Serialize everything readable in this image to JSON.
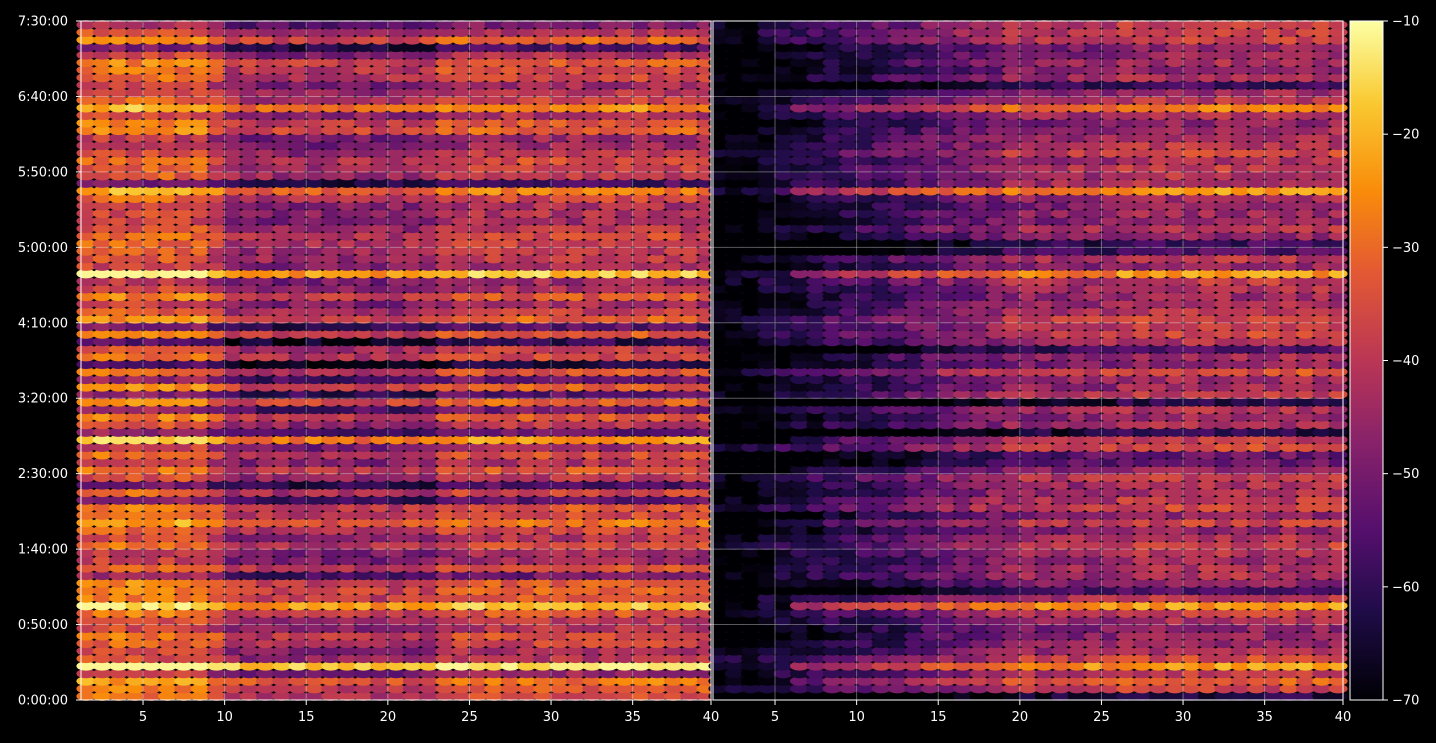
{
  "chart_data": {
    "type": "heatmap",
    "title": "",
    "xlabel": "",
    "ylabel": "",
    "panels": [
      {
        "name": "",
        "xlim": [
          1.2,
          39.8
        ],
        "x_tick_labels": [
          "5",
          "10",
          "15",
          "20",
          "25",
          "30",
          "35",
          "40"
        ],
        "x_tick_values": [
          5,
          10,
          15,
          20,
          25,
          30,
          35,
          40
        ],
        "rows": 90,
        "cols": 39,
        "description_level": "bright: levels mostly -45 to -25 dB, strong bands near -15 dB"
      },
      {
        "name": "",
        "xlim": [
          1.2,
          39.8
        ],
        "x_tick_labels": [
          "5",
          "10",
          "15",
          "20",
          "25",
          "30",
          "35",
          "40"
        ],
        "x_tick_values": [
          5,
          10,
          15,
          20,
          25,
          30,
          35,
          40
        ],
        "rows": 90,
        "cols": 39,
        "description_level": "dark left (x<6 ≈ -70 dB), rising to -45..-25 dB toward right"
      }
    ],
    "y_axis": {
      "ylim_seconds": [
        0,
        27000
      ],
      "tick_labels": [
        "0:00:00",
        "0:50:00",
        "1:40:00",
        "2:30:00",
        "3:20:00",
        "4:10:00",
        "5:00:00",
        "5:50:00",
        "6:40:00",
        "7:30:00"
      ],
      "tick_values_seconds": [
        0,
        3000,
        6000,
        9000,
        12000,
        15000,
        18000,
        21000,
        24000,
        27000
      ]
    },
    "colorbar": {
      "colormap": "inferno",
      "range": [
        -70,
        -10
      ],
      "tick_labels": [
        "−10",
        "−20",
        "−30",
        "−40",
        "−50",
        "−60",
        "−70"
      ],
      "tick_values": [
        -10,
        -20,
        -30,
        -40,
        -50,
        -60,
        -70
      ]
    },
    "strong_band_times_seconds": [
      [
        690,
        29
      ],
      [
        1350,
        23
      ],
      [
        3750,
        28
      ],
      [
        6950,
        26
      ],
      [
        10400,
        27
      ],
      [
        12900,
        28
      ],
      [
        13800,
        27
      ],
      [
        17000,
        26
      ],
      [
        20200,
        25
      ],
      [
        23600,
        25
      ]
    ],
    "grid": true,
    "colors": {
      "background": "#000000",
      "grid": "#ffffff",
      "axes": "#ffffff"
    }
  }
}
